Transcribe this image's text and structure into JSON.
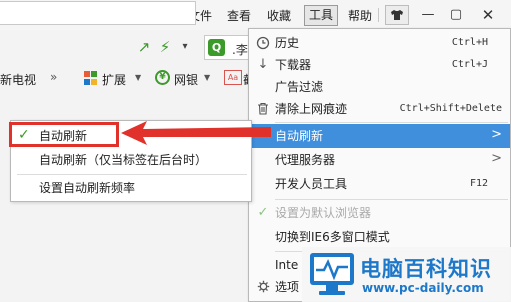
{
  "menubar": {
    "chevron": ">",
    "file": "文件",
    "view": "查看",
    "favorites": "收藏",
    "tools": "工具",
    "help": "帮助",
    "shirt_icon": "shirt-icon",
    "min": "—",
    "max": "▢",
    "close": "✕"
  },
  "addressbar": {
    "share_icon": "↗",
    "bolt_icon": "⚡",
    "chevron": "▾",
    "search_icon_glyph": "Q",
    "search_text": ".李"
  },
  "bookmarks": {
    "tv": "新电视",
    "more": "»",
    "extensions": "扩展",
    "ext_arrow": "▼",
    "bank_icon": "¥",
    "bank": "网银",
    "bank_arrow": "▼",
    "ad_icon": "Aa",
    "ad_text": "截"
  },
  "tools_menu": {
    "items": [
      {
        "icon": "history-icon",
        "glyph": "◷",
        "label": "历史",
        "shortcut": "Ctrl+H"
      },
      {
        "icon": "download-icon",
        "glyph": "↓",
        "label": "下载器",
        "shortcut": "Ctrl+J"
      },
      {
        "icon": "",
        "glyph": "",
        "label": "广告过滤",
        "shortcut": ""
      },
      {
        "icon": "trash-icon",
        "glyph": "🗑",
        "label": "清除上网痕迹",
        "shortcut": "Ctrl+Shift+Delete"
      },
      {
        "icon": "",
        "glyph": "",
        "label": "自动刷新",
        "shortcut": "",
        "arrow": ">"
      },
      {
        "icon": "",
        "glyph": "",
        "label": "代理服务器",
        "shortcut": "",
        "arrow": ">"
      },
      {
        "icon": "",
        "glyph": "",
        "label": "开发人员工具",
        "shortcut": "F12"
      },
      {
        "icon": "check-icon",
        "glyph": "✓",
        "label": "设置为默认浏览器",
        "shortcut": ""
      },
      {
        "icon": "",
        "glyph": "",
        "label": "切换到IE6多窗口模式",
        "shortcut": ""
      },
      {
        "icon": "",
        "glyph": "",
        "label": "Inte",
        "shortcut": ""
      },
      {
        "icon": "gear-icon",
        "glyph": "⚙",
        "label": "选项",
        "shortcut": ""
      }
    ]
  },
  "submenu": {
    "check_glyph": "✓",
    "items": [
      "自动刷新",
      "自动刷新（仅当标签在后台时）",
      "设置自动刷新频率"
    ]
  },
  "watermark": {
    "title": "电脑百科知识",
    "url": "www.pc-daily.com"
  },
  "colors": {
    "highlight": "#3f8fdd",
    "annotation_red": "#e0312b",
    "accent_green": "#3c9a2a",
    "watermark_blue": "#1d78c9"
  }
}
